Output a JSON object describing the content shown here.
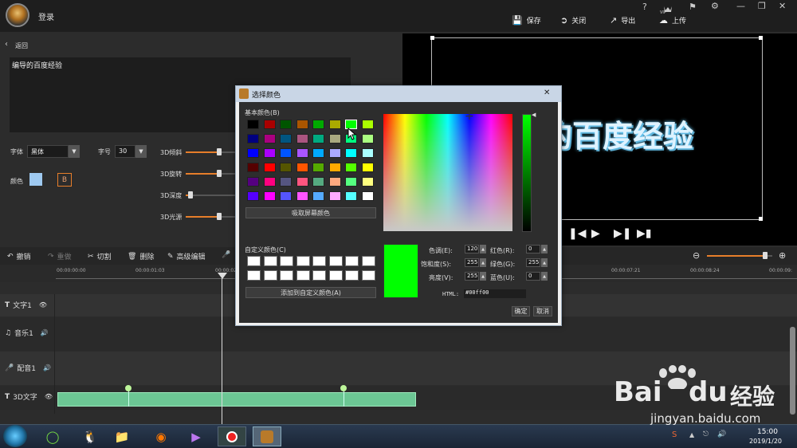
{
  "app": {
    "title": "登录",
    "help": "?",
    "vip": "VIP"
  },
  "toolbar_top": {
    "save": "保存",
    "close": "关闭",
    "export": "导出",
    "upload": "上传"
  },
  "left": {
    "back": "返回",
    "text": "编导的百度经验",
    "font_label": "字体",
    "font_value": "黑体",
    "size_label": "字号",
    "size_value": "30",
    "color_label": "颜色",
    "bold": "B",
    "sliders": [
      {
        "label": "3D倾斜",
        "value": 0.42
      },
      {
        "label": "3D旋转",
        "value": 0.42
      },
      {
        "label": "3D深度",
        "value": 0.06
      },
      {
        "label": "3D光源",
        "value": 0.42
      }
    ]
  },
  "preview": {
    "text": "的百度经验"
  },
  "edit": {
    "undo": "撤销",
    "redo": "重做",
    "cut": "切割",
    "delete": "删除",
    "advanced": "高级编辑"
  },
  "ruler": [
    "00:00:00:00",
    "00:00:01:03",
    "00:00:02:06",
    "00:00:07:21",
    "00:00:08:24",
    "00:00:09:"
  ],
  "tracks": [
    {
      "label": "文字1"
    },
    {
      "label": "音乐1"
    },
    {
      "label": "配音1"
    },
    {
      "label": "3D文字"
    }
  ],
  "dialog": {
    "title": "选择颜色",
    "basic": "基本颜色(B)",
    "pick": "吸取屏幕颜色",
    "custom": "自定义颜色(C)",
    "add": "添加到自定义颜色(A)",
    "hue_label": "色调(E):",
    "hue": "120",
    "sat_label": "饱和度(S):",
    "sat": "255",
    "val_label": "亮度(V):",
    "val": "255",
    "red_label": "红色(R):",
    "red": "0",
    "green_label": "绿色(G):",
    "green": "255",
    "blue_label": "蓝色(U):",
    "blue": "0",
    "html_label": "HTML:",
    "html": "#00ff00",
    "ok": "确定",
    "cancel": "取消",
    "colors": [
      "#000000",
      "#aa0000",
      "#005500",
      "#aa5500",
      "#00aa00",
      "#aaaa00",
      "#00ff00",
      "#aaff00",
      "#000080",
      "#aa0080",
      "#005580",
      "#aa5580",
      "#00aa80",
      "#aaaa80",
      "#00ff80",
      "#aaff80",
      "#0000ff",
      "#aa00ff",
      "#0055ff",
      "#aa55ff",
      "#00aaff",
      "#aaaaff",
      "#00ffff",
      "#aaffff",
      "#550000",
      "#ff0000",
      "#555500",
      "#ff5500",
      "#55aa00",
      "#ffaa00",
      "#55ff00",
      "#ffff00",
      "#550080",
      "#ff0080",
      "#555580",
      "#ff5580",
      "#55aa80",
      "#ffaa80",
      "#55ff80",
      "#ffff80",
      "#5500ff",
      "#ff00ff",
      "#5555ff",
      "#ff55ff",
      "#55aaff",
      "#ffaaff",
      "#55ffff",
      "#ffffff"
    ],
    "selected": "#00ff00"
  },
  "clock": {
    "time": "15:00",
    "date": "2019/1/20"
  },
  "watermark": {
    "brand": "Bai",
    "brand2": "du",
    "brand3": "经验",
    "url": "jingyan.baidu.com"
  }
}
